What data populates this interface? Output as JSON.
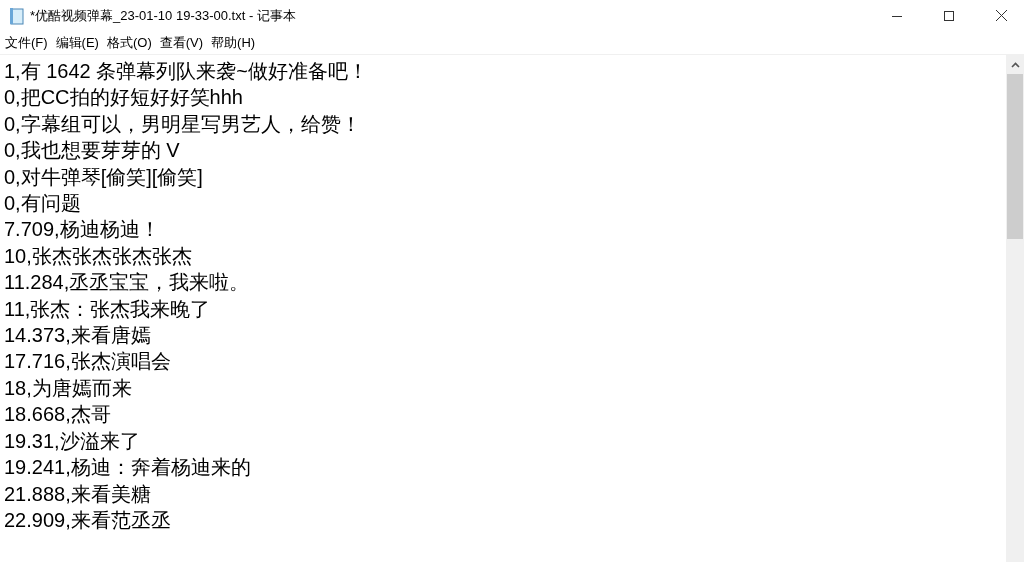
{
  "window": {
    "title": "*优酷视频弹幕_23-01-10 19-33-00.txt - 记事本"
  },
  "menu": [
    "文件(F)",
    "编辑(E)",
    "格式(O)",
    "查看(V)",
    "帮助(H)"
  ],
  "lines": [
    "1,有 1642 条弹幕列队来袭~做好准备吧！",
    "0,把CC拍的好短好好笑hhh",
    "0,字幕组可以，男明星写男艺人，给赞！",
    "0,我也想要芽芽的 V",
    "0,对牛弹琴[偷笑][偷笑]",
    "0,有问题",
    "7.709,杨迪杨迪！",
    "10,张杰张杰张杰张杰",
    "11.284,丞丞宝宝，我来啦。",
    "11,张杰：张杰我来晚了",
    "14.373,来看唐嫣",
    "17.716,张杰演唱会",
    "18,为唐嫣而来",
    "18.668,杰哥",
    "19.31,沙溢来了",
    "19.241,杨迪：奔着杨迪来的",
    "21.888,来看美糖",
    "22.909,来看范丞丞"
  ]
}
